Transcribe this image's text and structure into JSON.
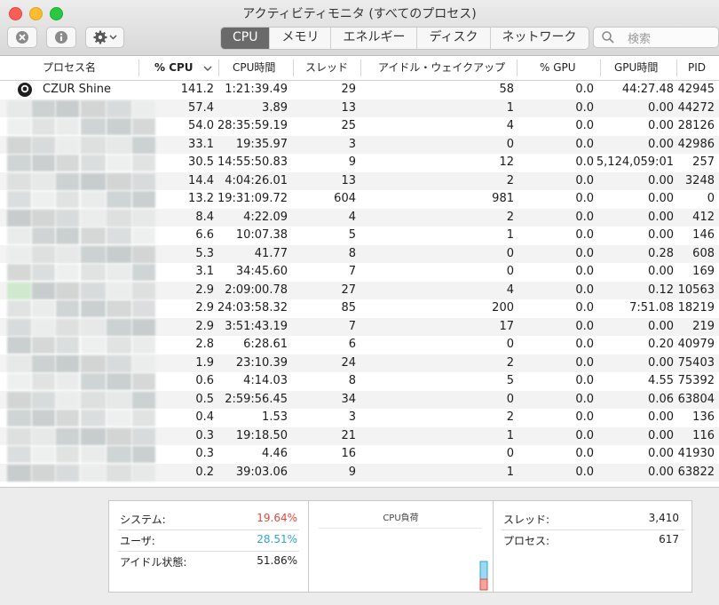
{
  "window": {
    "title": "アクティビティモニタ (すべてのプロセス)"
  },
  "toolbar": {
    "close_icon": "x-circle-icon",
    "info_icon": "info-icon",
    "gear_icon": "gear-icon",
    "tabs": [
      "CPU",
      "メモリ",
      "エネルギー",
      "ディスク",
      "ネットワーク"
    ],
    "search_placeholder": "検索"
  },
  "columns": {
    "name": "プロセス名",
    "cpu": "% CPU",
    "cpu_time": "CPU時間",
    "threads": "スレッド",
    "idle_wakeups": "アイドル・ウェイクアップ",
    "gpu": "% GPU",
    "gpu_time": "GPU時間",
    "pid": "PID"
  },
  "rows": [
    {
      "name": "CZUR Shine",
      "cpu": "141.2",
      "cpu_time": "1:21:39.49",
      "threads": "29",
      "idle": "58",
      "gpu": "0.0",
      "gpu_time": "44:27.48",
      "pid": "42945"
    },
    {
      "name": "",
      "cpu": "57.4",
      "cpu_time": "3.89",
      "threads": "13",
      "idle": "1",
      "gpu": "0.0",
      "gpu_time": "0.00",
      "pid": "44272"
    },
    {
      "name": "",
      "cpu": "54.0",
      "cpu_time": "28:35:59.19",
      "threads": "25",
      "idle": "4",
      "gpu": "0.0",
      "gpu_time": "0.00",
      "pid": "28126"
    },
    {
      "name": "",
      "cpu": "33.1",
      "cpu_time": "19:35.97",
      "threads": "3",
      "idle": "0",
      "gpu": "0.0",
      "gpu_time": "0.00",
      "pid": "42986"
    },
    {
      "name": "",
      "cpu": "30.5",
      "cpu_time": "14:55:50.83",
      "threads": "9",
      "idle": "12",
      "gpu": "0.0",
      "gpu_time": "5,124,059:01",
      "pid": "257"
    },
    {
      "name": "",
      "cpu": "14.4",
      "cpu_time": "4:04:26.01",
      "threads": "13",
      "idle": "2",
      "gpu": "0.0",
      "gpu_time": "0.00",
      "pid": "3248"
    },
    {
      "name": "",
      "cpu": "13.2",
      "cpu_time": "19:31:09.72",
      "threads": "604",
      "idle": "981",
      "gpu": "0.0",
      "gpu_time": "0.00",
      "pid": "0"
    },
    {
      "name": "",
      "cpu": "8.4",
      "cpu_time": "4:22.09",
      "threads": "4",
      "idle": "2",
      "gpu": "0.0",
      "gpu_time": "0.00",
      "pid": "412"
    },
    {
      "name": "",
      "cpu": "6.6",
      "cpu_time": "10:07.38",
      "threads": "5",
      "idle": "1",
      "gpu": "0.0",
      "gpu_time": "0.00",
      "pid": "146"
    },
    {
      "name": "",
      "cpu": "5.3",
      "cpu_time": "41.77",
      "threads": "8",
      "idle": "0",
      "gpu": "0.0",
      "gpu_time": "0.28",
      "pid": "608"
    },
    {
      "name": "",
      "cpu": "3.1",
      "cpu_time": "34:45.60",
      "threads": "7",
      "idle": "0",
      "gpu": "0.0",
      "gpu_time": "0.00",
      "pid": "169"
    },
    {
      "name": "",
      "cpu": "2.9",
      "cpu_time": "2:09:00.78",
      "threads": "27",
      "idle": "4",
      "gpu": "0.0",
      "gpu_time": "0.12",
      "pid": "10563"
    },
    {
      "name": "",
      "cpu": "2.9",
      "cpu_time": "24:03:58.32",
      "threads": "85",
      "idle": "200",
      "gpu": "0.0",
      "gpu_time": "7:51.08",
      "pid": "18219"
    },
    {
      "name": "",
      "cpu": "2.9",
      "cpu_time": "3:51:43.19",
      "threads": "7",
      "idle": "17",
      "gpu": "0.0",
      "gpu_time": "0.00",
      "pid": "219"
    },
    {
      "name": "",
      "cpu": "2.8",
      "cpu_time": "6:28.61",
      "threads": "6",
      "idle": "0",
      "gpu": "0.0",
      "gpu_time": "0.20",
      "pid": "40979"
    },
    {
      "name": "",
      "cpu": "1.9",
      "cpu_time": "23:10.39",
      "threads": "24",
      "idle": "2",
      "gpu": "0.0",
      "gpu_time": "0.00",
      "pid": "75403"
    },
    {
      "name": "",
      "cpu": "0.6",
      "cpu_time": "4:14.03",
      "threads": "8",
      "idle": "5",
      "gpu": "0.0",
      "gpu_time": "4.55",
      "pid": "75392"
    },
    {
      "name": "",
      "cpu": "0.5",
      "cpu_time": "2:59:56.45",
      "threads": "34",
      "idle": "0",
      "gpu": "0.0",
      "gpu_time": "0.06",
      "pid": "63804"
    },
    {
      "name": "",
      "cpu": "0.4",
      "cpu_time": "1.53",
      "threads": "3",
      "idle": "2",
      "gpu": "0.0",
      "gpu_time": "0.00",
      "pid": "136"
    },
    {
      "name": "",
      "cpu": "0.3",
      "cpu_time": "19:18.50",
      "threads": "21",
      "idle": "1",
      "gpu": "0.0",
      "gpu_time": "0.00",
      "pid": "116"
    },
    {
      "name": "",
      "cpu": "0.3",
      "cpu_time": "4.46",
      "threads": "16",
      "idle": "0",
      "gpu": "0.0",
      "gpu_time": "0.00",
      "pid": "41930"
    },
    {
      "name": "",
      "cpu": "0.2",
      "cpu_time": "39:03.06",
      "threads": "9",
      "idle": "1",
      "gpu": "0.0",
      "gpu_time": "0.00",
      "pid": "63822"
    }
  ],
  "stats": {
    "system_label": "システム:",
    "system_value": "19.64%",
    "system_color": "#e0483e",
    "user_label": "ユーザ:",
    "user_value": "28.51%",
    "user_color": "#2fa4d8",
    "idle_label": "アイドル状態:",
    "idle_value": "51.86%",
    "cpu_load_label": "CPU負荷",
    "threads_label": "スレッド:",
    "threads_value": "3,410",
    "processes_label": "プロセス:",
    "processes_value": "617"
  }
}
